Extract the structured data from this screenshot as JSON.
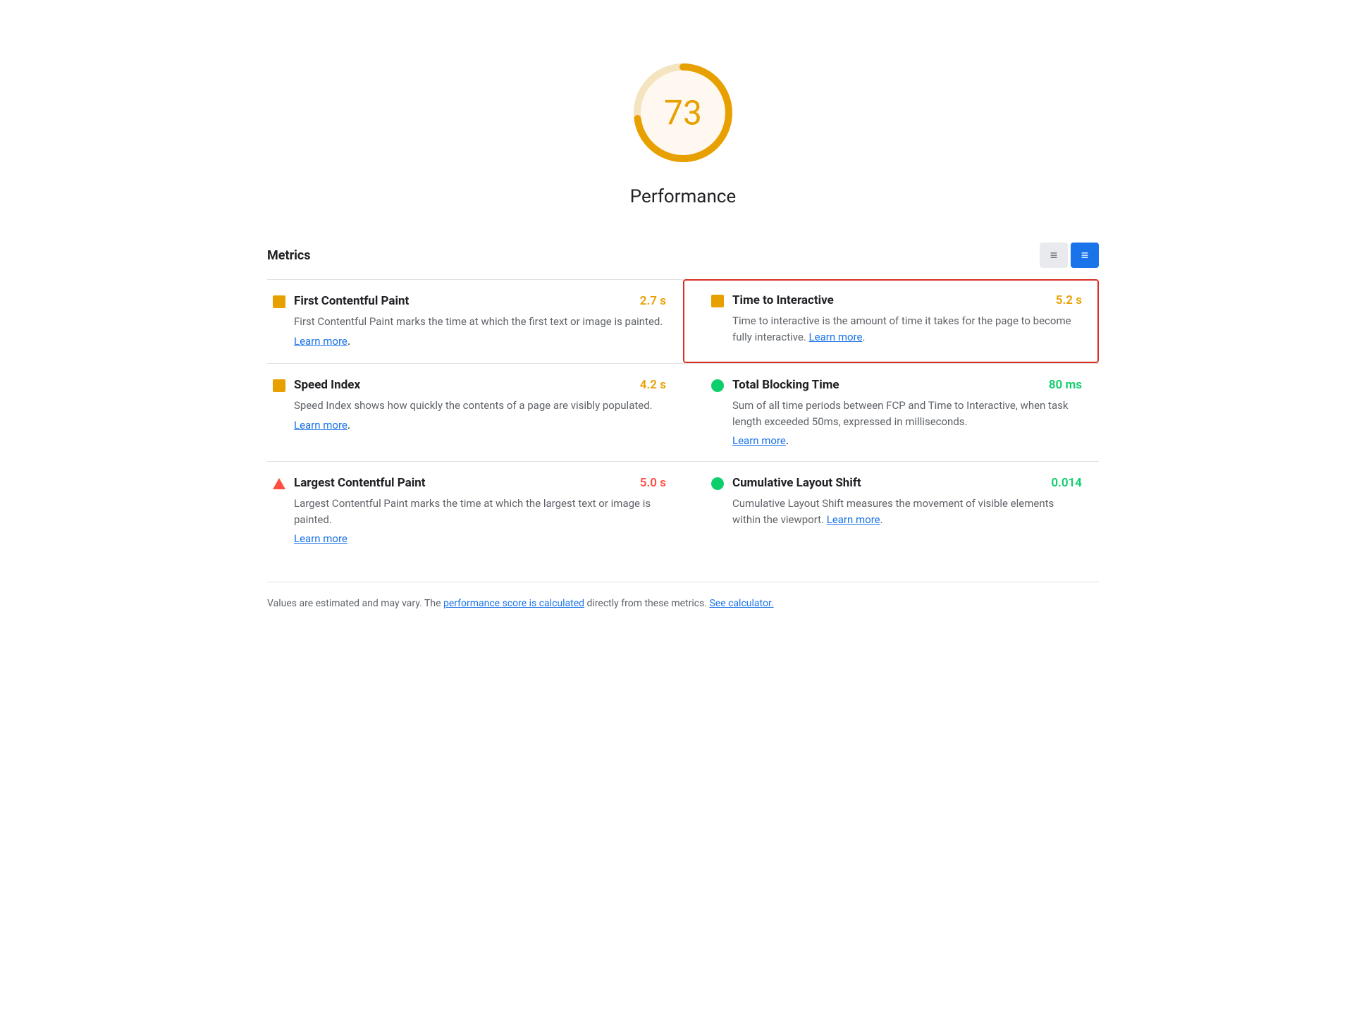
{
  "score": {
    "value": "73",
    "label": "Performance",
    "color": "#e8a000",
    "gauge_percent": 73
  },
  "metrics_section": {
    "title": "Metrics",
    "view_list_label": "≡",
    "view_detail_label": "≡"
  },
  "metrics": [
    {
      "id": "fcp",
      "name": "First Contentful Paint",
      "value": "2.7 s",
      "value_color": "orange",
      "icon": "square-orange",
      "description": "First Contentful Paint marks the time at which the first text or image is painted.",
      "learn_more_label": "Learn more",
      "learn_more_url": "#",
      "highlighted": false,
      "col": "left",
      "row": 1
    },
    {
      "id": "tti",
      "name": "Time to Interactive",
      "value": "5.2 s",
      "value_color": "orange",
      "icon": "square-orange",
      "description": "Time to interactive is the amount of time it takes for the page to become fully interactive.",
      "learn_more_label": "Learn more",
      "learn_more_url": "#",
      "highlighted": true,
      "col": "right",
      "row": 1
    },
    {
      "id": "si",
      "name": "Speed Index",
      "value": "4.2 s",
      "value_color": "orange",
      "icon": "square-orange",
      "description": "Speed Index shows how quickly the contents of a page are visibly populated.",
      "learn_more_label": "Learn more",
      "learn_more_url": "#",
      "highlighted": false,
      "col": "left",
      "row": 2
    },
    {
      "id": "tbt",
      "name": "Total Blocking Time",
      "value": "80 ms",
      "value_color": "green",
      "icon": "circle-green",
      "description": "Sum of all time periods between FCP and Time to Interactive, when task length exceeded 50ms, expressed in milliseconds.",
      "learn_more_label": "Learn more",
      "learn_more_url": "#",
      "highlighted": false,
      "col": "right",
      "row": 2
    },
    {
      "id": "lcp",
      "name": "Largest Contentful Paint",
      "value": "5.0 s",
      "value_color": "red",
      "icon": "triangle-red",
      "description": "Largest Contentful Paint marks the time at which the largest text or image is painted.",
      "learn_more_label": "Learn more",
      "learn_more_url": "#",
      "highlighted": false,
      "col": "left",
      "row": 3
    },
    {
      "id": "cls",
      "name": "Cumulative Layout Shift",
      "value": "0.014",
      "value_color": "green",
      "icon": "circle-green",
      "description": "Cumulative Layout Shift measures the movement of visible elements within the viewport.",
      "learn_more_label": "Learn more",
      "learn_more_url": "#",
      "highlighted": false,
      "col": "right",
      "row": 3
    }
  ],
  "footer": {
    "text_before": "Values are estimated and may vary. The ",
    "link1_label": "performance score is calculated",
    "text_middle": " directly from these metrics. ",
    "link2_label": "See calculator.",
    "link1_url": "#",
    "link2_url": "#"
  }
}
